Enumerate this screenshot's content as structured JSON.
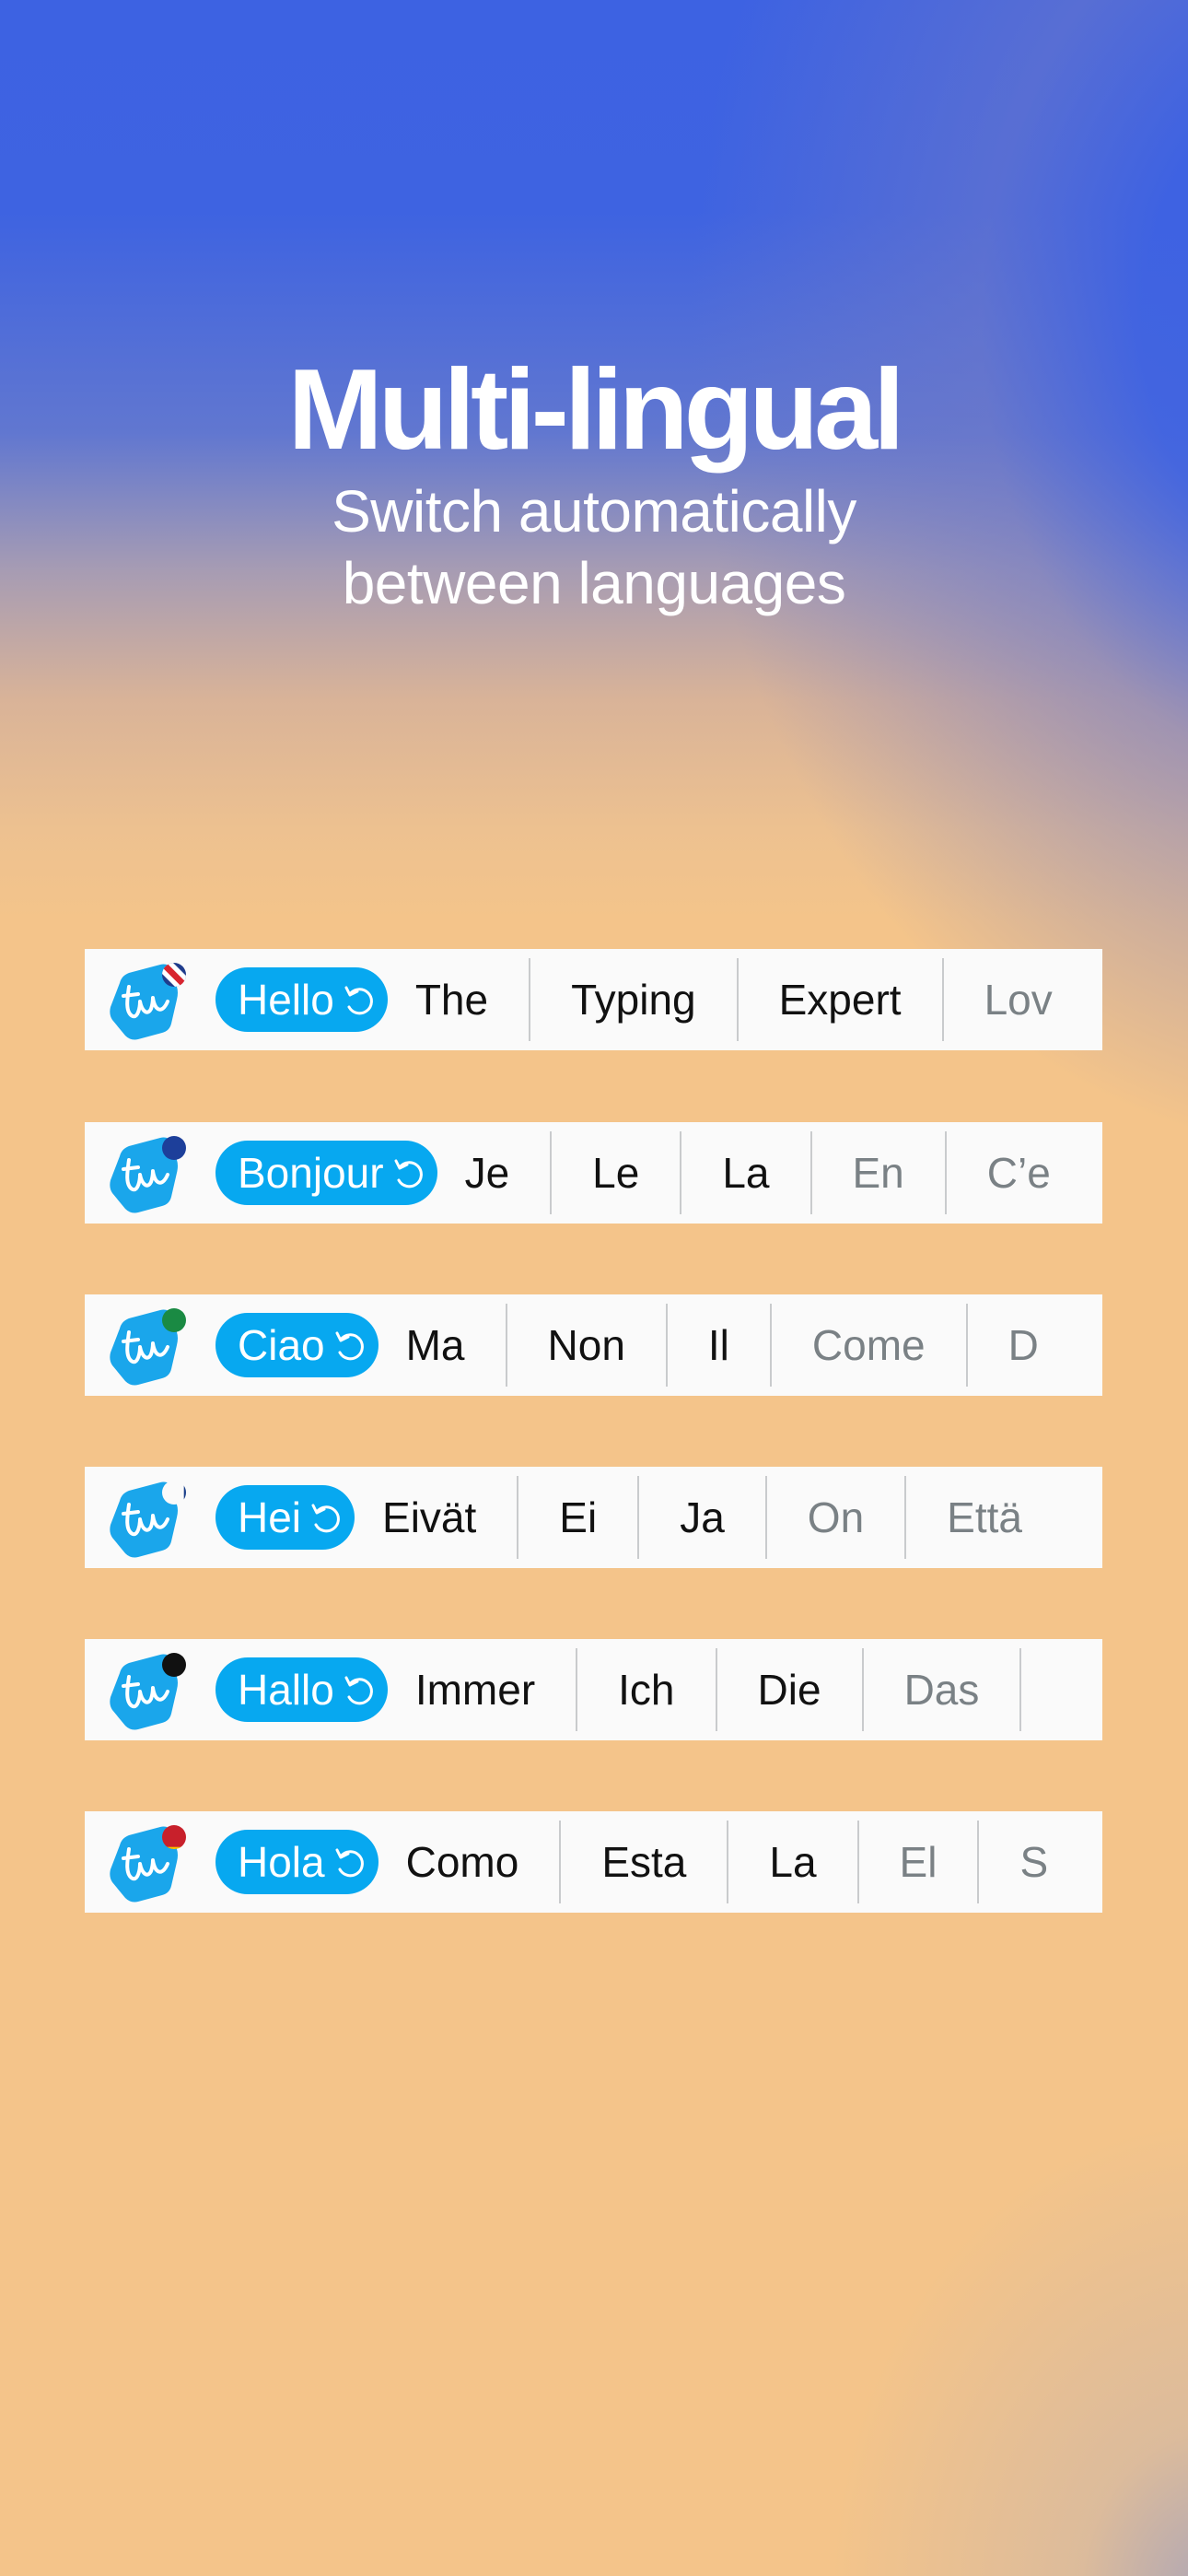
{
  "hero": {
    "title": "Multi-lingual",
    "subtitle_line1": "Switch automatically",
    "subtitle_line2": "between languages"
  },
  "colors": {
    "brand": "#07a8f0",
    "bar_background": "#fafafa",
    "word_active": "#111111",
    "word_dim": "#7a8185",
    "top_gradient": "#3d62e2",
    "bottom_gradient": "#f4c48a"
  },
  "keyboards": [
    {
      "language": "English",
      "flag_icon": "uk-flag-icon",
      "greeting": "Hello",
      "suggestions": [
        {
          "text": "The",
          "dim": false
        },
        {
          "text": "Typing",
          "dim": false
        },
        {
          "text": "Expert",
          "dim": false
        },
        {
          "text": "Lov",
          "dim": true
        }
      ]
    },
    {
      "language": "French",
      "flag_icon": "france-flag-icon",
      "greeting": "Bonjour",
      "suggestions": [
        {
          "text": "Je",
          "dim": false
        },
        {
          "text": "Le",
          "dim": false
        },
        {
          "text": "La",
          "dim": false
        },
        {
          "text": "En",
          "dim": true
        },
        {
          "text": "C’e",
          "dim": true
        }
      ]
    },
    {
      "language": "Italian",
      "flag_icon": "italy-flag-icon",
      "greeting": "Ciao",
      "suggestions": [
        {
          "text": "Ma",
          "dim": false
        },
        {
          "text": "Non",
          "dim": false
        },
        {
          "text": "Il",
          "dim": false
        },
        {
          "text": "Come",
          "dim": true
        },
        {
          "text": "D",
          "dim": true
        }
      ]
    },
    {
      "language": "Finnish",
      "flag_icon": "finland-flag-icon",
      "greeting": "Hei",
      "suggestions": [
        {
          "text": "Eivät",
          "dim": false
        },
        {
          "text": "Ei",
          "dim": false
        },
        {
          "text": "Ja",
          "dim": false
        },
        {
          "text": "On",
          "dim": true
        },
        {
          "text": "Että",
          "dim": true
        }
      ]
    },
    {
      "language": "German",
      "flag_icon": "germany-flag-icon",
      "greeting": "Hallo",
      "suggestions": [
        {
          "text": "Immer",
          "dim": false
        },
        {
          "text": "Ich",
          "dim": false
        },
        {
          "text": "Die",
          "dim": false
        },
        {
          "text": "Das",
          "dim": true
        }
      ]
    },
    {
      "language": "Spanish",
      "flag_icon": "spain-flag-icon",
      "greeting": "Hola",
      "suggestions": [
        {
          "text": "Como",
          "dim": false
        },
        {
          "text": "Esta",
          "dim": false
        },
        {
          "text": "La",
          "dim": false
        },
        {
          "text": "El",
          "dim": true
        },
        {
          "text": "S",
          "dim": true
        }
      ]
    }
  ]
}
